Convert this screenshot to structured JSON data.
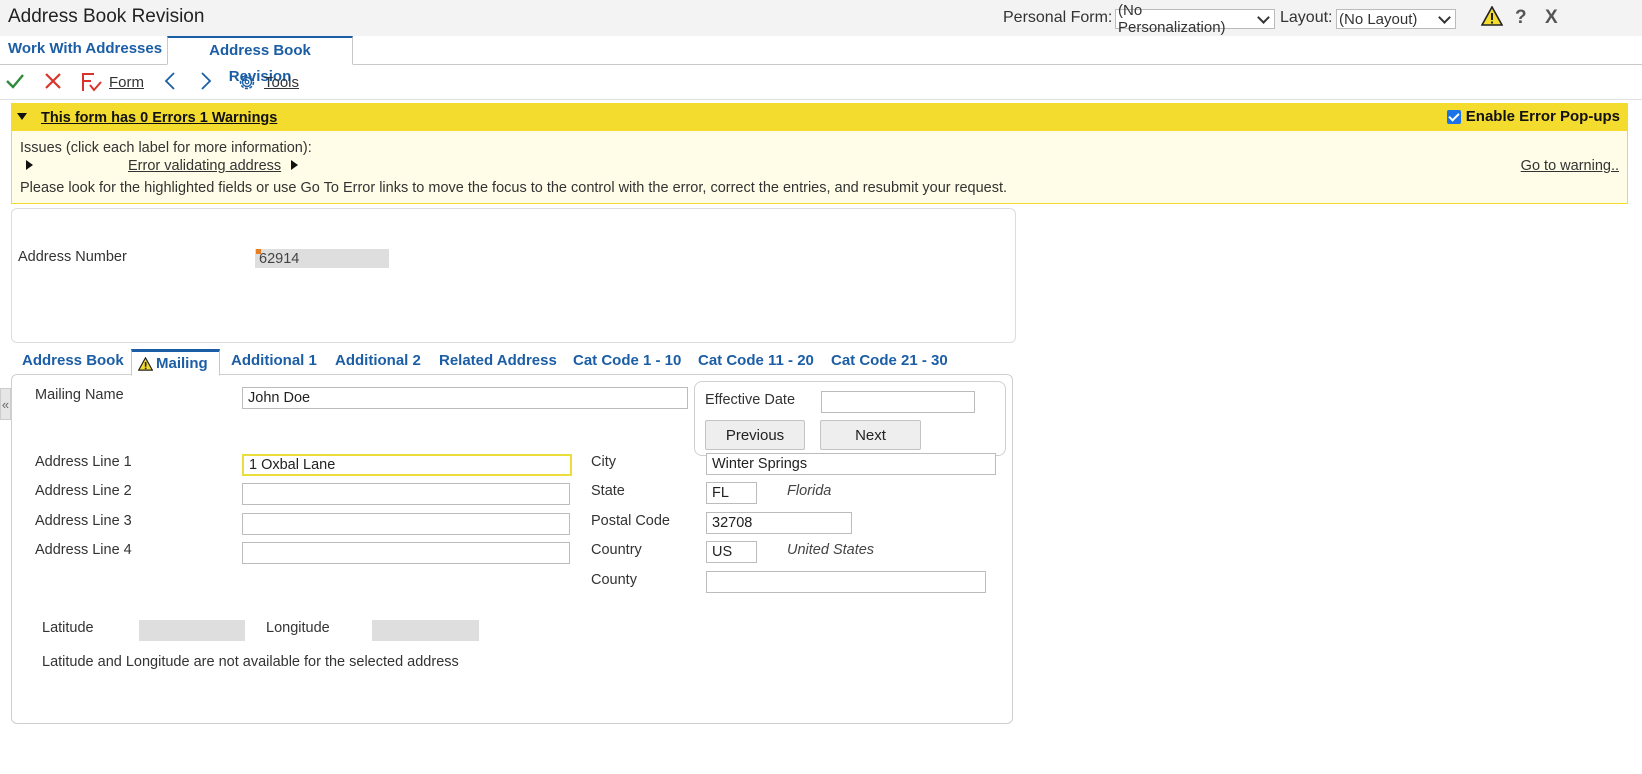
{
  "header": {
    "title": "Address Book Revision",
    "personal_form_label": "Personal Form:",
    "personal_form_value": "(No Personalization)",
    "layout_label": "Layout:",
    "layout_value": "(No Layout)",
    "help_label": "?",
    "close_label": "X"
  },
  "tabs": [
    {
      "label": "Work With Addresses"
    },
    {
      "label": "Address Book Revision"
    }
  ],
  "toolbar": {
    "form_label": "Form",
    "tools_label": "Tools"
  },
  "banner": {
    "title": "This form has 0 Errors 1 Warnings",
    "enable_popups_label": "Enable Error Pop-ups",
    "issues_label": "Issues (click each label for more information):",
    "issue_link": "Error validating address",
    "goto_link": "Go to warning..",
    "instructions": "Please look for the highlighted fields or use Go To Error links to move the focus to the control with the error, correct the entries, and resubmit your request."
  },
  "address_number": {
    "label": "Address Number",
    "value": "62914"
  },
  "subtabs": [
    {
      "label": "Address Book"
    },
    {
      "label": "Mailing"
    },
    {
      "label": "Additional 1"
    },
    {
      "label": "Additional 2"
    },
    {
      "label": "Related Address"
    },
    {
      "label": "Cat Code 1 - 10"
    },
    {
      "label": "Cat Code 11 - 20"
    },
    {
      "label": "Cat Code 21 - 30"
    }
  ],
  "mailing": {
    "mailing_name_label": "Mailing Name",
    "mailing_name_value": "John Doe",
    "effective_date_label": "Effective Date",
    "effective_date_value": "",
    "previous_label": "Previous",
    "next_label": "Next",
    "address_line_1_label": "Address Line 1",
    "address_line_1_value": "1 Oxbal Lane",
    "address_line_2_label": "Address Line 2",
    "address_line_2_value": "",
    "address_line_3_label": "Address Line 3",
    "address_line_3_value": "",
    "address_line_4_label": "Address Line 4",
    "address_line_4_value": "",
    "city_label": "City",
    "city_value": "Winter Springs",
    "state_label": "State",
    "state_value": "FL",
    "state_desc": "Florida",
    "postal_code_label": "Postal Code",
    "postal_code_value": "32708",
    "country_label": "Country",
    "country_value": "US",
    "country_desc": "United States",
    "county_label": "County",
    "county_value": "",
    "latitude_label": "Latitude",
    "latitude_value": "",
    "longitude_label": "Longitude",
    "longitude_value": "",
    "geo_note": "Latitude and Longitude are not available for the selected address"
  },
  "colors": {
    "accent": "#1c5ea5",
    "warning": "#f4dc2f"
  }
}
